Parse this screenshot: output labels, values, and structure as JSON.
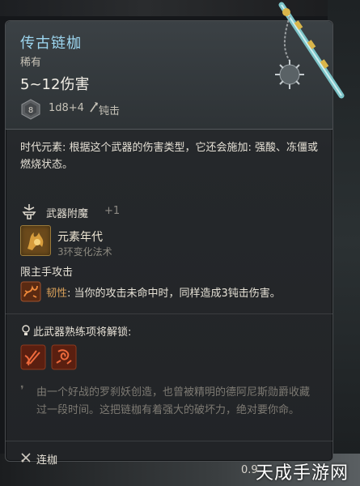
{
  "item": {
    "name": "传古链枷",
    "rarity": "稀有",
    "damage": "5~12伤害",
    "die_icon": "d8-die-icon",
    "die_face": "8",
    "dice": "1d8+4",
    "damage_type_icon": "bludgeon-icon",
    "damage_type": "钝击"
  },
  "lore": "时代元素: 根据这个武器的伤害类型，它还会施加: 强酸、冻僵或燃烧状态。",
  "enchant": {
    "icon": "anvil-icon",
    "label": "武器附魔",
    "value": "+1"
  },
  "spell": {
    "icon": "elemental-spell-icon",
    "name": "元素年代",
    "school": "3环变化法术"
  },
  "mainhand_label": "限主手攻击",
  "passive": {
    "icon": "passive-skill-icon",
    "name": "韧性",
    "text": ": 当你的攻击未命中时，同样造成3钝击伤害。"
  },
  "unlock": {
    "icon": "bulb-icon",
    "title": "此武器熟练项将解锁:",
    "masteries": [
      "mastery-slash-icon",
      "mastery-crush-icon"
    ]
  },
  "flavor": "由一个好战的罗刹妖创造，也曾被精明的德阿尼斯勋爵收藏过一段时间。这把链枷有着强大的破坏力，绝对要你命。",
  "weapon_type": {
    "icon": "flail-icon",
    "label": "连枷"
  },
  "weight": "0.9",
  "watermark": "天成手游网",
  "colors": {
    "name": "#9dd6f0",
    "passive_name": "#d9a05a",
    "panel": "#2c3033"
  }
}
